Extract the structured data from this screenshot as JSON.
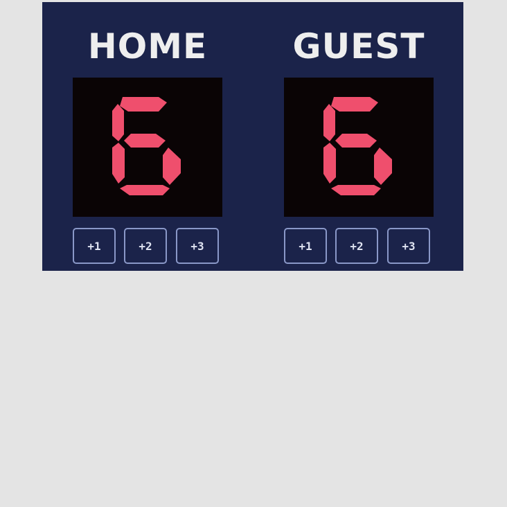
{
  "scoreboard": {
    "home": {
      "name": "HOME",
      "score": "6",
      "buttons": [
        "+1",
        "+2",
        "+3"
      ]
    },
    "guest": {
      "name": "GUEST",
      "score": "6",
      "buttons": [
        "+1",
        "+2",
        "+3"
      ]
    }
  },
  "colors": {
    "board_background": "#1b234a",
    "display_background": "#0a0405",
    "digit": "#ef4f6d",
    "button_border": "#8a98c8",
    "page_background": "#e4e4e4"
  }
}
